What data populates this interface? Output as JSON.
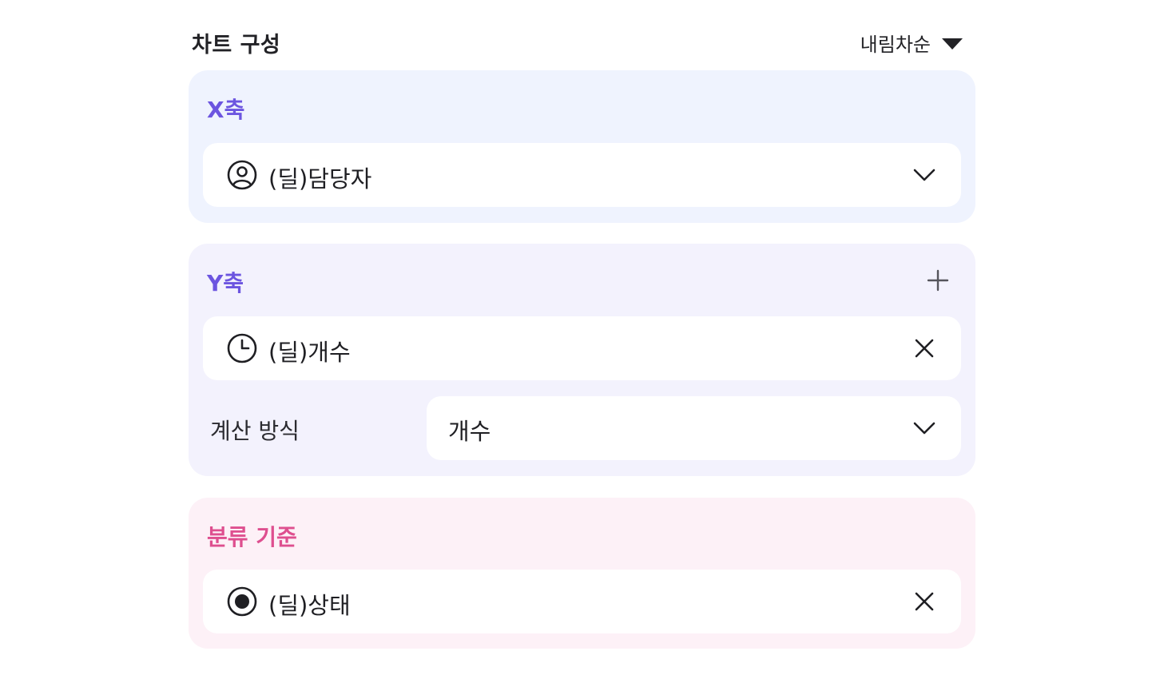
{
  "header": {
    "title": "차트 구성",
    "sort_label": "내림차순"
  },
  "x_axis": {
    "title": "X축",
    "field": {
      "label": "(딜)담당자",
      "icon": "person-circle-icon",
      "action_icon": "chevron-down-icon"
    }
  },
  "y_axis": {
    "title": "Y축",
    "add_icon": "plus-icon",
    "field": {
      "label": "(딜)개수",
      "icon": "clock-icon",
      "action_icon": "close-icon"
    },
    "calc": {
      "label": "계산 방식",
      "value": "개수",
      "action_icon": "chevron-down-icon"
    }
  },
  "group_by": {
    "title": "분류 기준",
    "field": {
      "label": "(딜)상태",
      "icon": "radio-dot-icon",
      "action_icon": "close-icon"
    }
  },
  "colors": {
    "x_card_bg": "#eff3fe",
    "y_card_bg": "#f3f2fd",
    "group_card_bg": "#fdf1f7",
    "axis_title": "#6c55e0",
    "group_title": "#de4f8f",
    "text": "#1f1f23"
  }
}
